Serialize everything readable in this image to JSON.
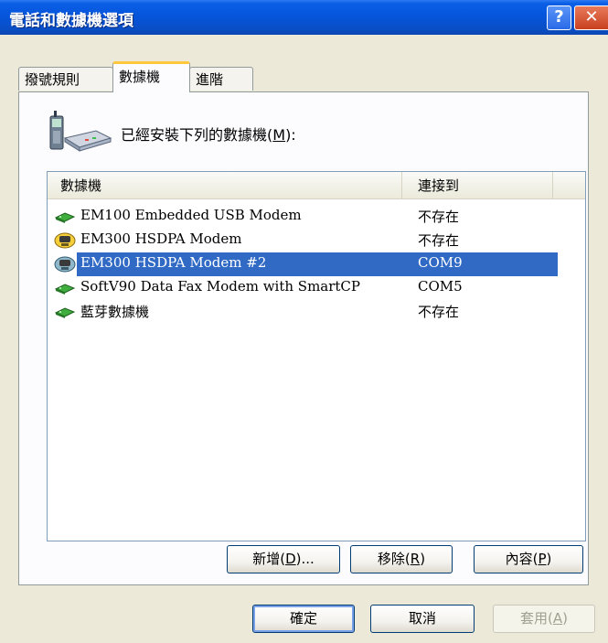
{
  "window": {
    "title": "電話和數據機選項",
    "help_glyph": "?",
    "close_glyph": "✕"
  },
  "tabs": [
    {
      "label": "撥號規則"
    },
    {
      "label": "數據機"
    },
    {
      "label": "進階"
    }
  ],
  "header": {
    "label_prefix": "已經安裝下列的數據機(",
    "label_key": "M",
    "label_suffix": "):"
  },
  "list": {
    "columns": [
      "數據機",
      "連接到"
    ],
    "rows": [
      {
        "name": "EM100 Embedded USB Modem",
        "connection": "不存在",
        "icon": "modem-card-icon"
      },
      {
        "name": "EM300 HSDPA Modem",
        "connection": "不存在",
        "icon": "phone-modem-icon"
      },
      {
        "name": "EM300 HSDPA Modem #2",
        "connection": "COM9",
        "icon": "phone-modem-icon",
        "selected": true
      },
      {
        "name": "SoftV90 Data Fax Modem with SmartCP",
        "connection": "COM5",
        "icon": "modem-card-icon"
      },
      {
        "name": "藍芽數據機",
        "connection": "不存在",
        "icon": "modem-card-icon"
      }
    ]
  },
  "panel_buttons": {
    "add": {
      "prefix": "新增(",
      "key": "D",
      "suffix": ")..."
    },
    "remove": {
      "prefix": "移除(",
      "key": "R",
      "suffix": ")"
    },
    "properties": {
      "prefix": "內容(",
      "key": "P",
      "suffix": ")"
    }
  },
  "dialog_buttons": {
    "ok": "確定",
    "cancel": "取消",
    "apply": {
      "prefix": "套用(",
      "key": "A",
      "suffix": ")"
    }
  },
  "colors": {
    "titlebar": "#0554d9",
    "selection": "#316ac5",
    "active_tab_accent": "#ffc83c"
  }
}
